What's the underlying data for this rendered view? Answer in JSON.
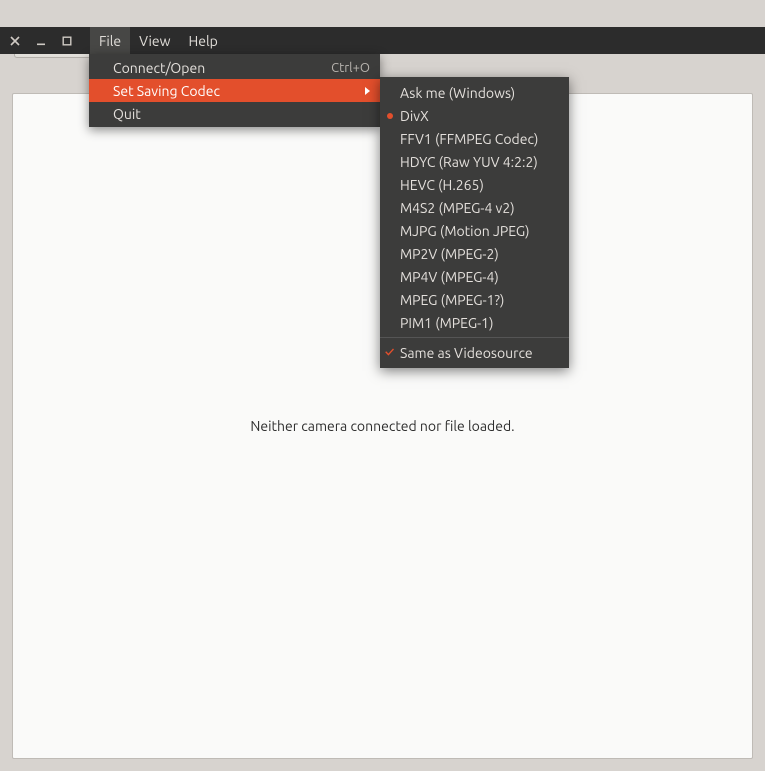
{
  "window": {
    "close_icon": "close-icon",
    "min_icon": "minimize-icon",
    "max_icon": "maximize-icon"
  },
  "menubar": {
    "items": [
      "File",
      "View",
      "Help"
    ],
    "activeIndex": 0
  },
  "toolbar": {
    "connect_label": "Connect/Open"
  },
  "main": {
    "empty_message": "Neither camera connected nor file loaded."
  },
  "file_menu": {
    "items": [
      {
        "label": "Connect/Open",
        "accel": "Ctrl+O"
      },
      {
        "label": "Set Saving Codec",
        "submenu": true,
        "highlight": true
      },
      {
        "label": "Quit"
      }
    ]
  },
  "codec_submenu": {
    "items": [
      {
        "label": "Ask me (Windows)"
      },
      {
        "label": "DivX",
        "selected": true
      },
      {
        "label": "FFV1 (FFMPEG Codec)"
      },
      {
        "label": "HDYC (Raw YUV 4:2:2)"
      },
      {
        "label": "HEVC (H.265)"
      },
      {
        "label": "M4S2 (MPEG-4 v2)"
      },
      {
        "label": "MJPG (Motion JPEG)"
      },
      {
        "label": "MP2V (MPEG-2)"
      },
      {
        "label": "MP4V (MPEG-4)"
      },
      {
        "label": "MPEG (MPEG-1?)"
      },
      {
        "label": "PIM1 (MPEG-1)"
      }
    ],
    "footer": {
      "label": "Same as Videosource",
      "checked": true
    }
  }
}
